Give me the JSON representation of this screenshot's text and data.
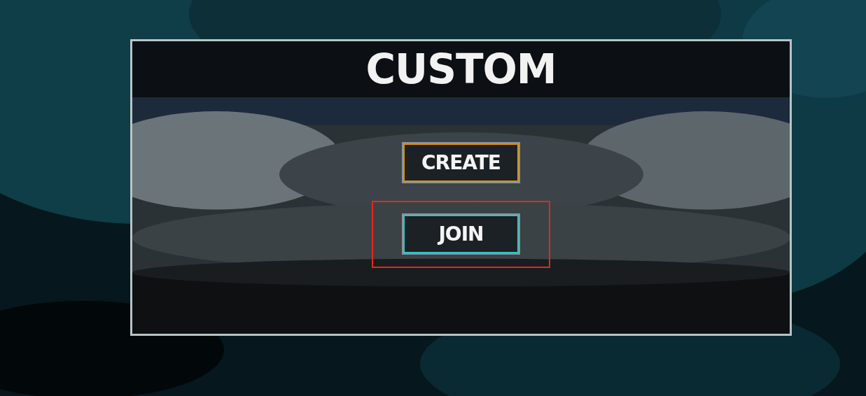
{
  "dialog": {
    "title": "CUSTOM"
  },
  "buttons": [
    {
      "label": "CREATE",
      "color": "#e0900a",
      "highlighted": false
    },
    {
      "label": "JOIN",
      "color": "#2fc4cc",
      "highlighted": true
    }
  ]
}
